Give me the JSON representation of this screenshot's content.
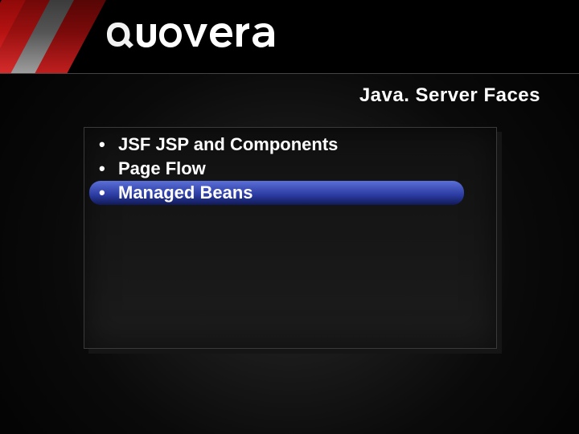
{
  "brand": {
    "name": "quovera"
  },
  "slide": {
    "title": "Java. Server Faces",
    "bullets": [
      {
        "text": "JSF JSP and Components",
        "highlight": false
      },
      {
        "text": "Page Flow",
        "highlight": false
      },
      {
        "text": "Managed Beans",
        "highlight": true
      }
    ]
  }
}
